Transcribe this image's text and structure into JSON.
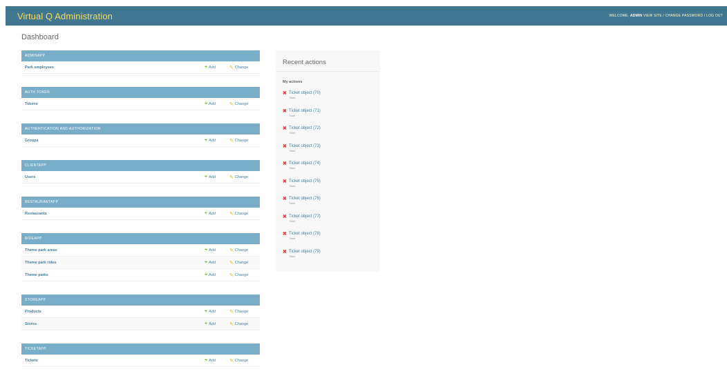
{
  "header": {
    "site_title": "Virtual Q Administration",
    "welcome": "WELCOME,",
    "username": "ADMIN",
    "view_site": "VIEW SITE",
    "separator": "/",
    "change_password": "CHANGE PASSWORD",
    "log_out": "LOG OUT"
  },
  "page_title": "Dashboard",
  "add_label": "Add",
  "change_label": "Change",
  "apps": [
    {
      "name": "ADMINAPP",
      "models": [
        "Park employees"
      ]
    },
    {
      "name": "AUTH TOKEN",
      "models": [
        "Tokens"
      ]
    },
    {
      "name": "AUTHENTICATION AND AUTHORIZATION",
      "models": [
        "Groups"
      ]
    },
    {
      "name": "CLIENTAPP",
      "models": [
        "Users"
      ]
    },
    {
      "name": "RESTAURANTAPP",
      "models": [
        "Restaurants"
      ]
    },
    {
      "name": "RIDEAPP",
      "models": [
        "Theme park areas",
        "Theme park rides",
        "Theme parks"
      ]
    },
    {
      "name": "STOREAPP",
      "models": [
        "Products",
        "Stores"
      ]
    },
    {
      "name": "TICKETAPP",
      "models": [
        "Tickets"
      ]
    }
  ],
  "recent": {
    "title": "Recent actions",
    "my_actions": "My actions",
    "items": [
      {
        "label": "Ticket object (70)",
        "type": "Ticket"
      },
      {
        "label": "Ticket object (71)",
        "type": "Ticket"
      },
      {
        "label": "Ticket object (72)",
        "type": "Ticket"
      },
      {
        "label": "Ticket object (73)",
        "type": "Ticket"
      },
      {
        "label": "Ticket object (74)",
        "type": "Ticket"
      },
      {
        "label": "Ticket object (75)",
        "type": "Ticket"
      },
      {
        "label": "Ticket object (76)",
        "type": "Ticket"
      },
      {
        "label": "Ticket object (77)",
        "type": "Ticket"
      },
      {
        "label": "Ticket object (78)",
        "type": "Ticket"
      },
      {
        "label": "Ticket object (79)",
        "type": "Ticket"
      }
    ]
  },
  "colors": {
    "header_bg": "#417690",
    "title_color": "#f5dd5d",
    "caption_bg": "#79aec8",
    "link": "#447e9b",
    "add_icon": "#70bf2b",
    "change_icon": "#efb80b",
    "delete_icon": "#dd4646"
  },
  "icons": {
    "add": "plus-icon",
    "change": "pencil-icon",
    "delete": "delete-x-icon"
  }
}
